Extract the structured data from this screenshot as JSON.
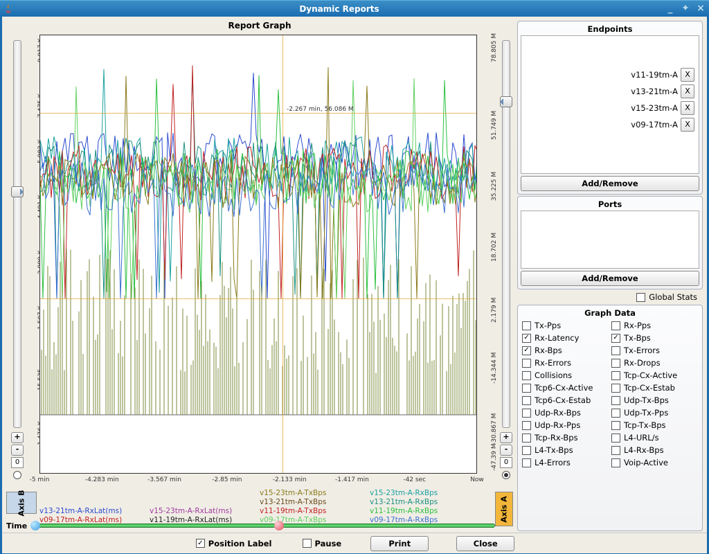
{
  "window": {
    "title": "Dynamic Reports"
  },
  "graph": {
    "title": "Report Graph",
    "annotation": "-2.267 min, 56.086 M",
    "axis_b_label": "Axis B",
    "axis_a_label": "Axis A",
    "left_spin": "0",
    "right_spin": "0"
  },
  "yleft_ticks": [
    "9.917 K",
    "7.475 K",
    "5.983 K",
    "4.491 K",
    "2.999 K",
    "1.507 K",
    "15.535",
    "-1.476 K"
  ],
  "yright_ticks": [
    "78.805 M",
    "51.749 M",
    "35.225 M",
    "18.702 M",
    "2.179 M",
    "-14.344 M",
    "-30.867 M",
    "-47.39 M"
  ],
  "x_ticks": [
    "-5 min",
    "-4.283 min",
    "-3.567 min",
    "-2.85 min",
    "-2.133 min",
    "-1.417 min",
    "-42 sec",
    "Now"
  ],
  "legend": [
    {
      "t": "v15-23tm-A-TxBps",
      "c": "#8a7a1a"
    },
    {
      "t": "v15-23tm-A-RxBps",
      "c": "#1aa0a0"
    },
    {
      "t": "v13-21tm-A-TxBps",
      "c": "#6a4a1a"
    },
    {
      "t": "v13-21tm-A-RxBps",
      "c": "#1a9080"
    },
    {
      "t": "v13-21tm-A-RxLat(ms)",
      "c": "#2a4ad0"
    },
    {
      "t": "v15-23tm-A-RxLat(ms)",
      "c": "#a03aa0"
    },
    {
      "t": "v11-19tm-A-TxBps",
      "c": "#c02020"
    },
    {
      "t": "v11-19tm-A-RxBps",
      "c": "#2ac040"
    },
    {
      "t": "v09-17tm-A-RxLat(ms)",
      "c": "#c02020"
    },
    {
      "t": "v11-19tm-A-RxLat(ms)",
      "c": "#202020"
    },
    {
      "t": "v09-17tm-A-TxBps",
      "c": "#60d060"
    },
    {
      "t": "v09-17tm-A-RxBps",
      "c": "#3a70d0"
    }
  ],
  "time_label": "Time",
  "endpoints": {
    "title": "Endpoints",
    "items": [
      "v11-19tm-A",
      "v13-21tm-A",
      "v15-23tm-A",
      "v09-17tm-A"
    ],
    "button": "Add/Remove"
  },
  "ports": {
    "title": "Ports",
    "button": "Add/Remove"
  },
  "global_stats_label": "Global Stats",
  "graph_data": {
    "title": "Graph Data",
    "items": [
      {
        "l": "Tx-Pps",
        "c": false
      },
      {
        "l": "Rx-Pps",
        "c": false
      },
      {
        "l": "Rx-Latency",
        "c": true
      },
      {
        "l": "Tx-Bps",
        "c": true
      },
      {
        "l": "Rx-Bps",
        "c": true
      },
      {
        "l": "Tx-Errors",
        "c": false
      },
      {
        "l": "Rx-Errors",
        "c": false
      },
      {
        "l": "Rx-Drops",
        "c": false
      },
      {
        "l": "Collisions",
        "c": false
      },
      {
        "l": "Tcp-Cx-Active",
        "c": false
      },
      {
        "l": "Tcp6-Cx-Active",
        "c": false
      },
      {
        "l": "Tcp-Cx-Estab",
        "c": false
      },
      {
        "l": "Tcp6-Cx-Estab",
        "c": false
      },
      {
        "l": "Udp-Tx-Bps",
        "c": false
      },
      {
        "l": "Udp-Rx-Bps",
        "c": false
      },
      {
        "l": "Udp-Tx-Pps",
        "c": false
      },
      {
        "l": "Udp-Rx-Pps",
        "c": false
      },
      {
        "l": "Tcp-Tx-Bps",
        "c": false
      },
      {
        "l": "Tcp-Rx-Bps",
        "c": false
      },
      {
        "l": "L4-URL/s",
        "c": false
      },
      {
        "l": "L4-Tx-Bps",
        "c": false
      },
      {
        "l": "L4-Rx-Bps",
        "c": false
      },
      {
        "l": "L4-Errors",
        "c": false
      },
      {
        "l": "Voip-Active",
        "c": false
      }
    ]
  },
  "bottom": {
    "position_label": "Position Label",
    "pause": "Pause",
    "print": "Print",
    "close": "Close"
  },
  "chart_data": {
    "type": "line",
    "title": "Report Graph",
    "xlabel": "",
    "ylabel_left": "",
    "ylabel_right": "",
    "x_range_sec": [
      -300,
      0
    ],
    "yleft_range": [
      -1476,
      9917
    ],
    "yright_range": [
      -47390000,
      78805000
    ],
    "crosshair": {
      "x_min": -2.267,
      "y_right": 56086000
    },
    "left_axis_series": [
      "v13-21tm-A-RxLat(ms)",
      "v15-23tm-A-RxLat(ms)",
      "v09-17tm-A-RxLat(ms)",
      "v11-19tm-A-RxLat(ms)"
    ],
    "right_axis_series": [
      "v15-23tm-A-TxBps",
      "v15-23tm-A-RxBps",
      "v13-21tm-A-TxBps",
      "v13-21tm-A-RxBps",
      "v11-19tm-A-TxBps",
      "v11-19tm-A-RxBps",
      "v09-17tm-A-TxBps",
      "v09-17tm-A-RxBps"
    ],
    "note": "dense noisy telemetry; values fluctuate roughly 4.5K–7.5K on left axis for latency series, 2M–80M on right axis for Bps series with many downward spikes"
  }
}
